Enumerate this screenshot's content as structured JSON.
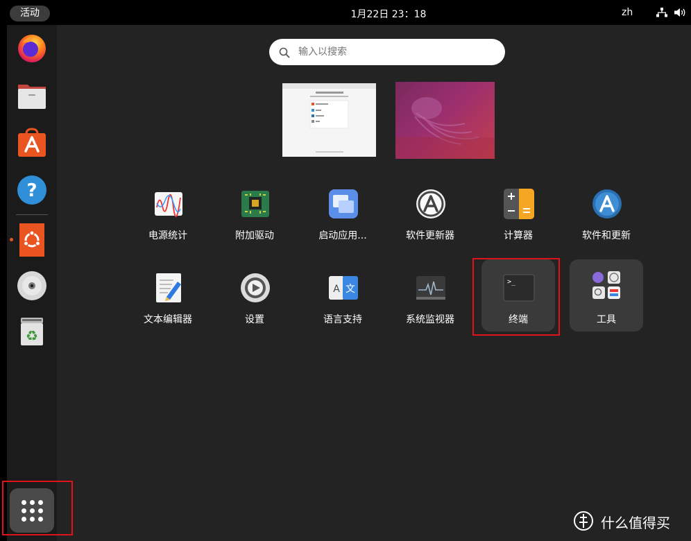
{
  "topbar": {
    "activities_label": "活动",
    "clock": "1月22日  23：18",
    "language": "zh"
  },
  "search": {
    "placeholder": "输入以搜索"
  },
  "apps_row1": [
    {
      "label": "电源统计"
    },
    {
      "label": "附加驱动"
    },
    {
      "label": "启动应用..."
    },
    {
      "label": "软件更新器"
    },
    {
      "label": "计算器"
    },
    {
      "label": "软件和更新"
    }
  ],
  "apps_row2": [
    {
      "label": "文本编辑器"
    },
    {
      "label": "设置"
    },
    {
      "label": "语言支持"
    },
    {
      "label": "系统监视器"
    },
    {
      "label": "终端"
    },
    {
      "label": "工具"
    }
  ],
  "watermark": "什么值得买",
  "colors": {
    "accent": "#e95420",
    "highlight": "#e0131b"
  }
}
